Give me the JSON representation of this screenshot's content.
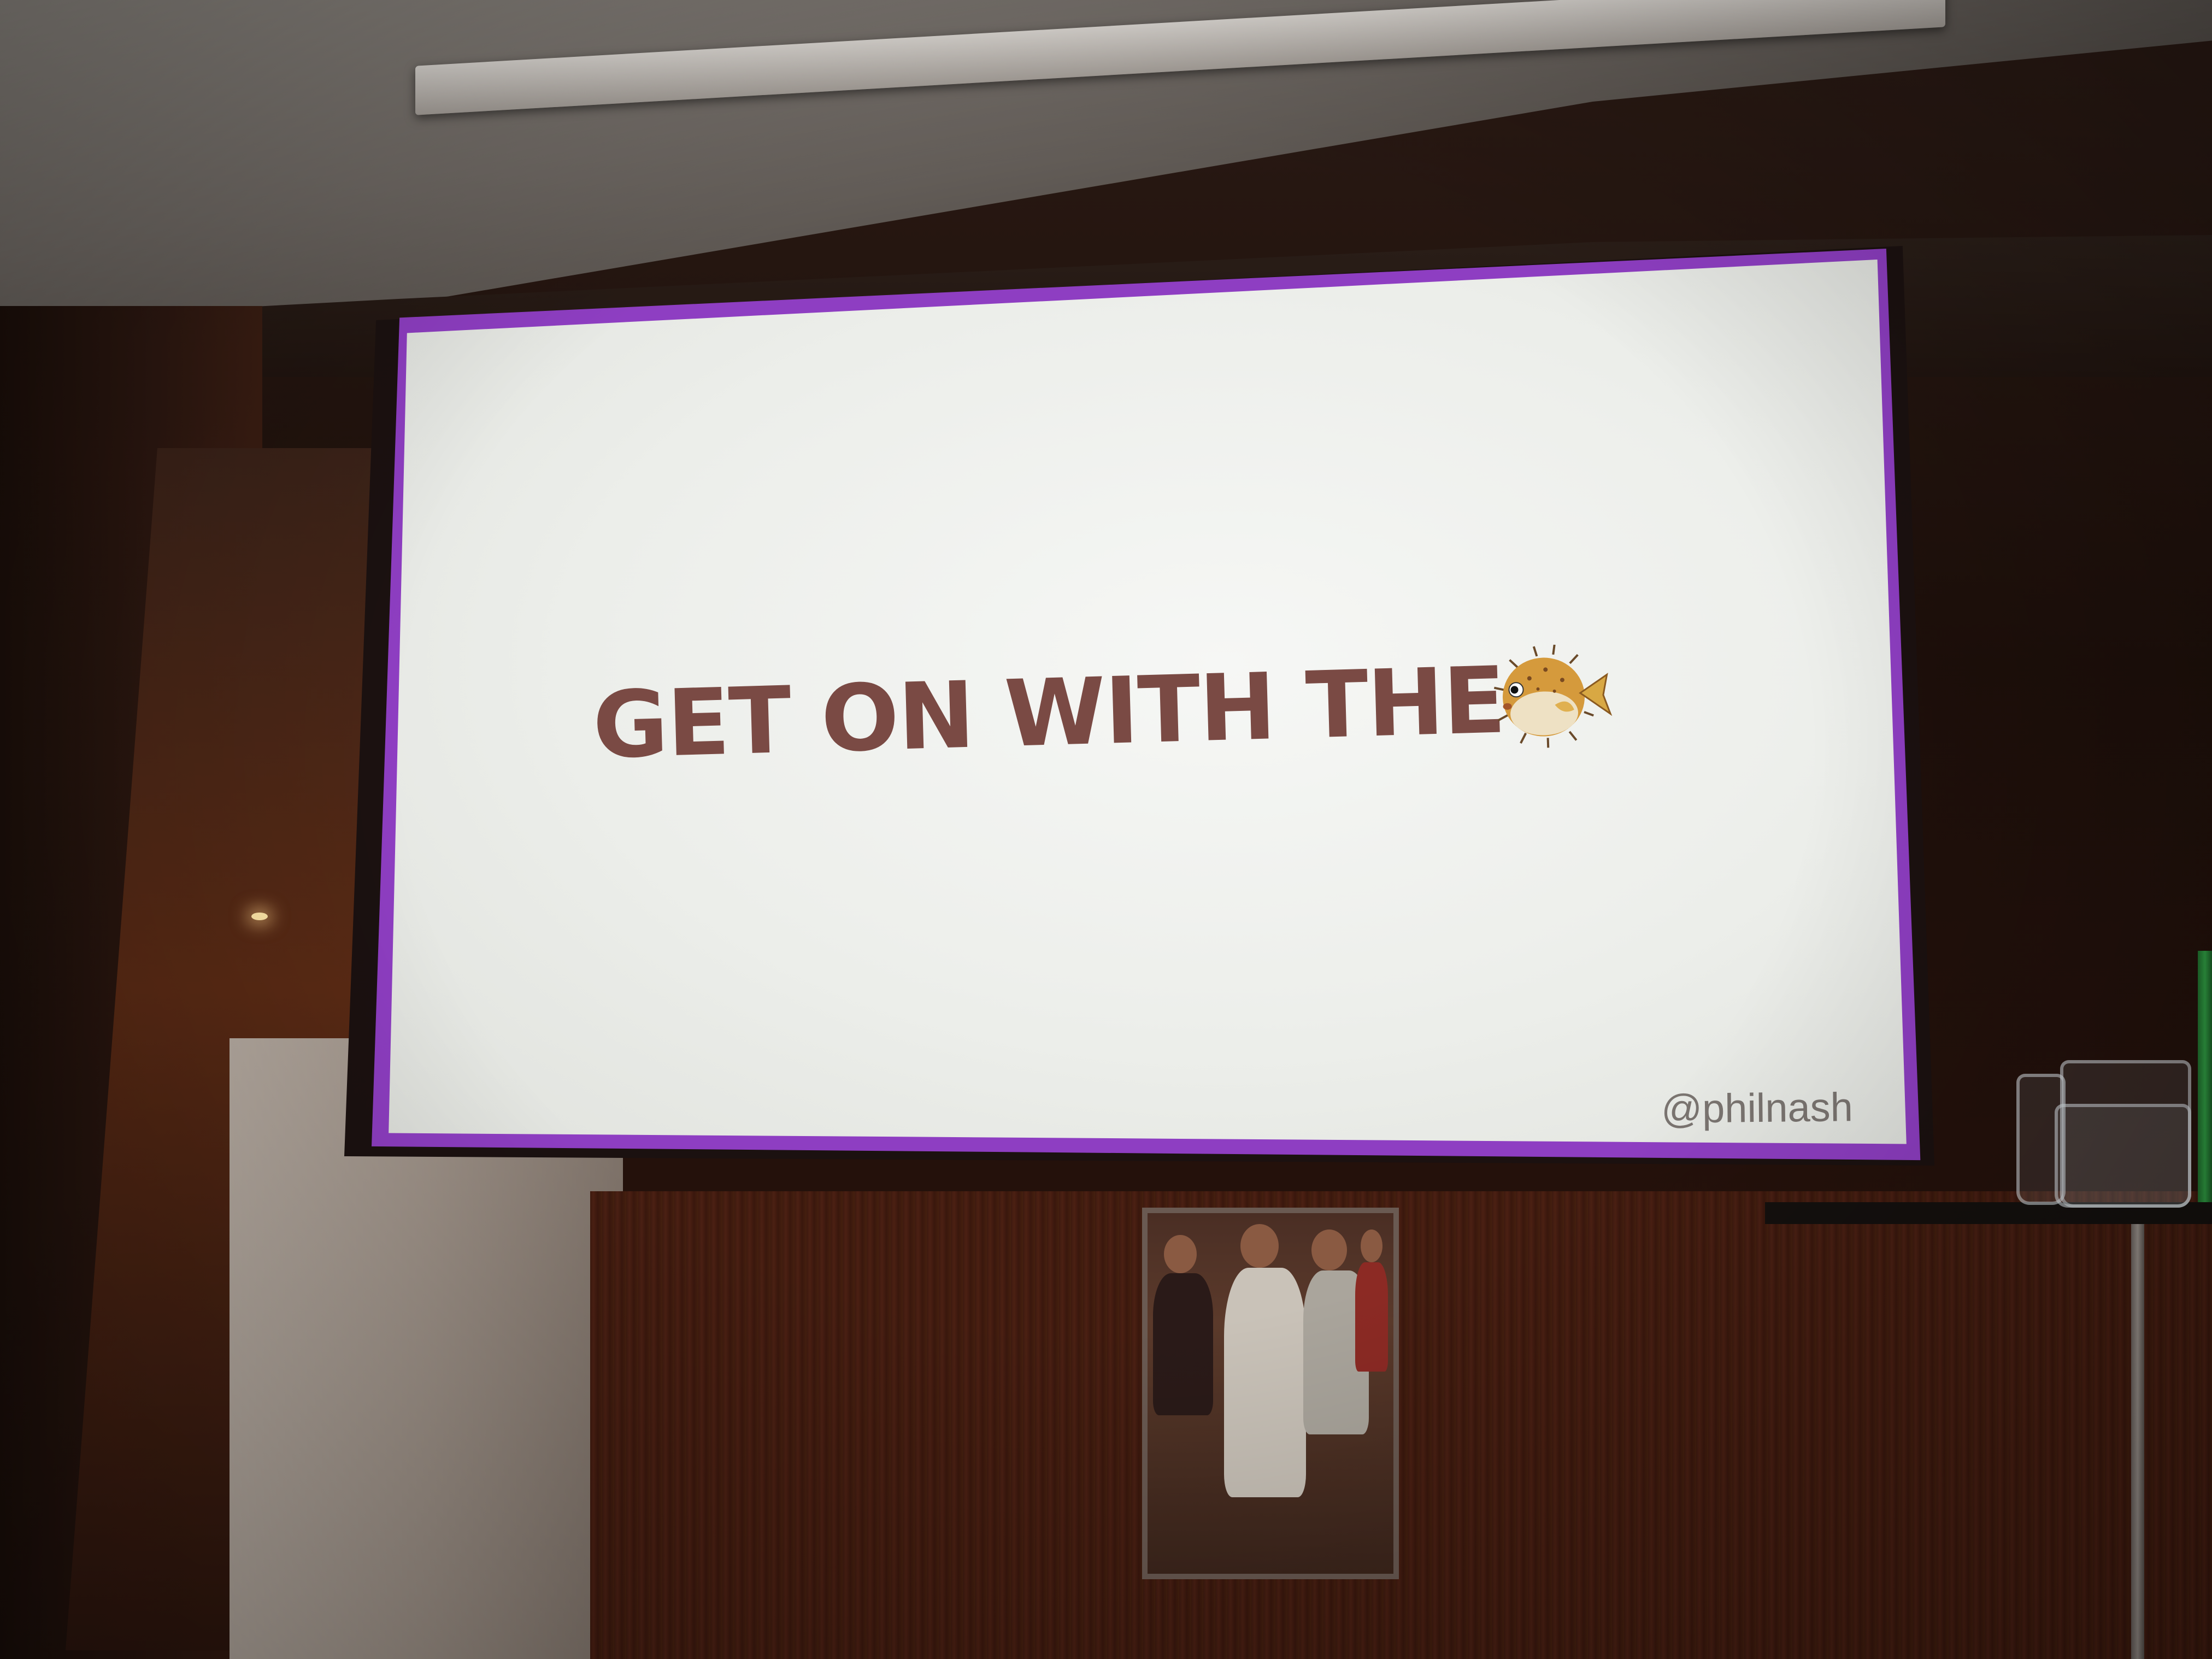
{
  "slide": {
    "title": "GET ON WITH THE",
    "emoji_icon": "pufferfish-icon",
    "handle": "@philnash",
    "title_color": "#7a4a44",
    "border_color": "#8e3ec2",
    "background_color": "#eceeea"
  }
}
